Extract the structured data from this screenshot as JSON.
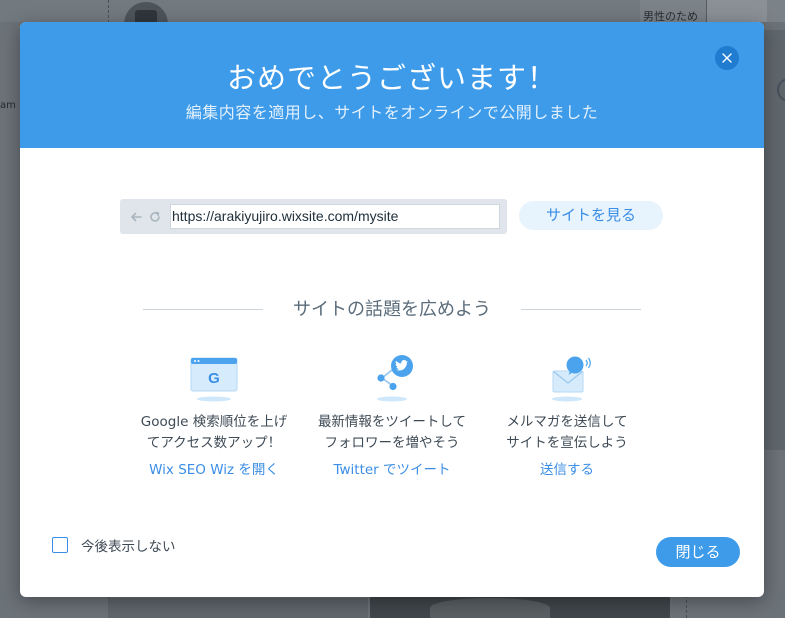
{
  "background": {
    "right_text": "男性のため",
    "left_text": "am"
  },
  "modal": {
    "title": "おめでとうございます！",
    "subtitle": "編集内容を適用し、サイトをオンラインで公開しました",
    "close_icon": "close-icon",
    "url": {
      "value": "https://arakiyujiro.wixsite.com/mysite",
      "back_icon": "back-arrow-icon",
      "refresh_icon": "refresh-icon"
    },
    "view_site_label": "サイトを見る",
    "share_heading": "サイトの話題を広めよう",
    "features": [
      {
        "icon": "google-seo-icon",
        "desc_line1": "Google 検索順位を上げ",
        "desc_line2": "てアクセス数アップ！",
        "link": "Wix SEO Wiz を開く"
      },
      {
        "icon": "twitter-share-icon",
        "desc_line1": "最新情報をツイートして",
        "desc_line2": "フォロワーを増やそう",
        "link": "Twitter でツイート"
      },
      {
        "icon": "email-newsletter-icon",
        "desc_line1": "メルマガを送信して",
        "desc_line2": "サイトを宣伝しよう",
        "link": "送信する"
      }
    ],
    "dont_show_label": "今後表示しない",
    "close_label": "閉じる"
  },
  "colors": {
    "header": "#3d9be9",
    "accent": "#3b8ee5",
    "close_circle": "#1f7cd0"
  }
}
